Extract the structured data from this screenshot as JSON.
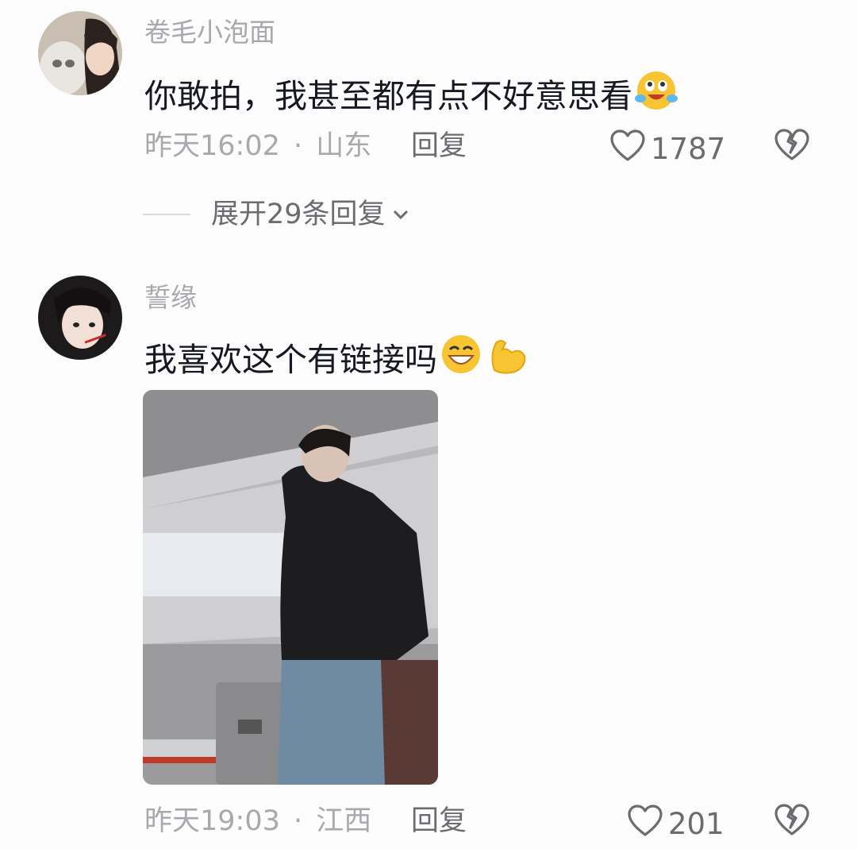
{
  "comments": [
    {
      "username": "卷毛小泡面",
      "text": "你敢拍，我甚至都有点不好意思看",
      "emojis": [
        "crying-laughing-emoji"
      ],
      "time": "昨天16:02",
      "separator": "·",
      "location": "山东",
      "reply_label": "回复",
      "likes": "1787",
      "expand_label": "展开29条回复"
    },
    {
      "username": "誓缘",
      "text": "我喜欢这个有链接吗",
      "emojis": [
        "grinning-emoji",
        "flexed-biceps-emoji"
      ],
      "time": "昨天19:03",
      "separator": "·",
      "location": "江西",
      "reply_label": "回复",
      "likes": "201"
    }
  ],
  "colors": {
    "background": "#fcfcfc",
    "text_primary": "#161823",
    "text_secondary": "#a8a8ad",
    "action_gray": "#6b6b70",
    "emoji_yellow": "#f7c531"
  }
}
